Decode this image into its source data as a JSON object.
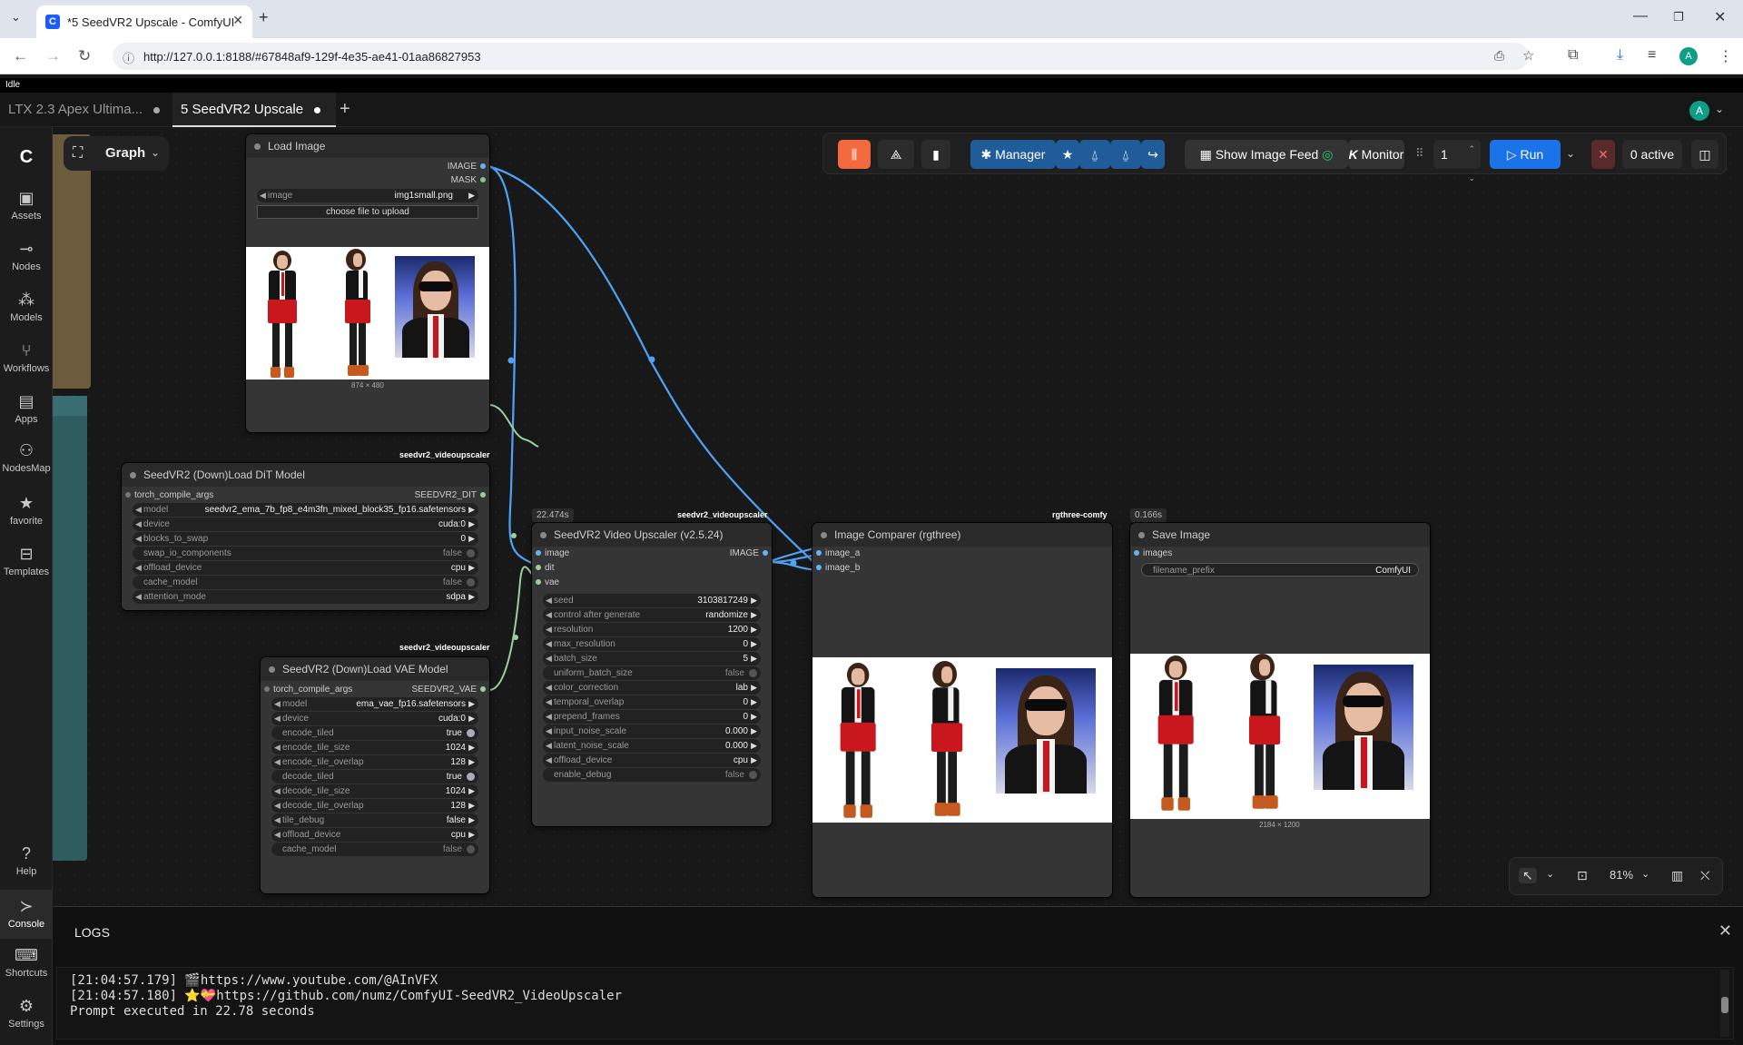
{
  "browser": {
    "tab_title": "*5 SeedVR2 Upscale - ComfyUI",
    "favicon": "C",
    "url": "http://127.0.0.1:8188/#67848af9-129f-4e35-ae41-01aa86827953",
    "profile_initial": "A"
  },
  "status": "Idle",
  "workflow_tabs": [
    {
      "label": "LTX 2.3 Apex Ultima...",
      "active": false
    },
    {
      "label": "5 SeedVR2 Upscale",
      "active": true
    }
  ],
  "user_initial": "A",
  "sidebar": {
    "items": [
      {
        "label": "Assets",
        "icon": "image-icon"
      },
      {
        "label": "Nodes",
        "icon": "nodes-icon"
      },
      {
        "label": "Models",
        "icon": "models-icon"
      },
      {
        "label": "Workflows",
        "icon": "workflows-icon"
      },
      {
        "label": "Apps",
        "icon": "apps-icon"
      },
      {
        "label": "NodesMap",
        "icon": "nodesmap-icon"
      },
      {
        "label": "favorite",
        "icon": "star-icon"
      },
      {
        "label": "Templates",
        "icon": "templates-icon"
      },
      {
        "label": "Help",
        "icon": "help-icon"
      },
      {
        "label": "Console",
        "icon": "console-icon"
      },
      {
        "label": "Shortcuts",
        "icon": "keyboard-icon"
      },
      {
        "label": "Settings",
        "icon": "gear-icon"
      }
    ]
  },
  "graph_menu": {
    "label": "Graph"
  },
  "action_bar": {
    "manager": "Manager",
    "show_image_feed": "Show Image Feed",
    "monitor": "Monitor",
    "queue_count": "1",
    "run": "Run",
    "active": "0 active"
  },
  "nodes": {
    "load_image": {
      "title": "Load Image",
      "out_image": "IMAGE",
      "out_mask": "MASK",
      "image_label": "image",
      "image_value": "img1small.png",
      "upload": "choose file to upload",
      "dims": "874 × 480"
    },
    "dit": {
      "badge": "seedvr2_videoupscaler",
      "title": "SeedVR2 (Down)Load DiT Model",
      "in_compile": "torch_compile_args",
      "out": "SEEDVR2_DIT",
      "widgets": [
        {
          "label": "model",
          "value": "seedvr2_ema_7b_fp8_e4m3fn_mixed_block35_fp16.safetensors",
          "kind": "combo"
        },
        {
          "label": "device",
          "value": "cuda:0",
          "kind": "combo"
        },
        {
          "label": "blocks_to_swap",
          "value": "0",
          "kind": "number"
        },
        {
          "label": "swap_io_components",
          "value": "false",
          "kind": "toggle"
        },
        {
          "label": "offload_device",
          "value": "cpu",
          "kind": "combo"
        },
        {
          "label": "cache_model",
          "value": "false",
          "kind": "toggle"
        },
        {
          "label": "attention_mode",
          "value": "sdpa",
          "kind": "combo"
        }
      ]
    },
    "vae": {
      "badge": "seedvr2_videoupscaler",
      "title": "SeedVR2 (Down)Load VAE Model",
      "in_compile": "torch_compile_args",
      "out": "SEEDVR2_VAE",
      "widgets": [
        {
          "label": "model",
          "value": "ema_vae_fp16.safetensors",
          "kind": "combo"
        },
        {
          "label": "device",
          "value": "cuda:0",
          "kind": "combo"
        },
        {
          "label": "encode_tiled",
          "value": "true",
          "kind": "toggle-on"
        },
        {
          "label": "encode_tile_size",
          "value": "1024",
          "kind": "number"
        },
        {
          "label": "encode_tile_overlap",
          "value": "128",
          "kind": "number"
        },
        {
          "label": "decode_tiled",
          "value": "true",
          "kind": "toggle-on"
        },
        {
          "label": "decode_tile_size",
          "value": "1024",
          "kind": "number"
        },
        {
          "label": "decode_tile_overlap",
          "value": "128",
          "kind": "number"
        },
        {
          "label": "tile_debug",
          "value": "false",
          "kind": "combo"
        },
        {
          "label": "offload_device",
          "value": "cpu",
          "kind": "combo"
        },
        {
          "label": "cache_model",
          "value": "false",
          "kind": "toggle"
        }
      ]
    },
    "upscaler": {
      "badge": "seedvr2_videoupscaler",
      "time": "22.474s",
      "title": "SeedVR2 Video Upscaler (v2.5.24)",
      "in_image": "image",
      "in_dit": "dit",
      "in_vae": "vae",
      "out": "IMAGE",
      "widgets": [
        {
          "label": "seed",
          "value": "3103817249",
          "kind": "number"
        },
        {
          "label": "control after generate",
          "value": "randomize",
          "kind": "combo"
        },
        {
          "label": "resolution",
          "value": "1200",
          "kind": "number"
        },
        {
          "label": "max_resolution",
          "value": "0",
          "kind": "number"
        },
        {
          "label": "batch_size",
          "value": "5",
          "kind": "number"
        },
        {
          "label": "uniform_batch_size",
          "value": "false",
          "kind": "toggle"
        },
        {
          "label": "color_correction",
          "value": "lab",
          "kind": "combo"
        },
        {
          "label": "temporal_overlap",
          "value": "0",
          "kind": "number"
        },
        {
          "label": "prepend_frames",
          "value": "0",
          "kind": "number"
        },
        {
          "label": "input_noise_scale",
          "value": "0.000",
          "kind": "number"
        },
        {
          "label": "latent_noise_scale",
          "value": "0.000",
          "kind": "number"
        },
        {
          "label": "offload_device",
          "value": "cpu",
          "kind": "combo"
        },
        {
          "label": "enable_debug",
          "value": "false",
          "kind": "toggle"
        }
      ]
    },
    "comparer": {
      "badge": "rgthree-comfy",
      "title": "Image Comparer (rgthree)",
      "in_a": "image_a",
      "in_b": "image_b"
    },
    "save": {
      "time": "0.166s",
      "title": "Save Image",
      "in_images": "images",
      "prefix_label": "filename_prefix",
      "prefix_value": "ComfyUI",
      "dims": "2184 × 1200"
    }
  },
  "canvas_controls": {
    "zoom": "81%"
  },
  "logs": {
    "header": "LOGS",
    "lines": [
      "[21:04:57.179] 🎬https://www.youtube.com/@AInVFX",
      "[21:04:57.180] ⭐💝https://github.com/numz/ComfyUI-SeedVR2_VideoUpscaler",
      "Prompt executed in 22.78 seconds"
    ]
  },
  "colors": {
    "link": "#4fa3f7",
    "run": "#1a73e8",
    "manager": "#1f5c99",
    "accent_orange": "#f26a3d",
    "accent_green": "#2ecc71"
  }
}
